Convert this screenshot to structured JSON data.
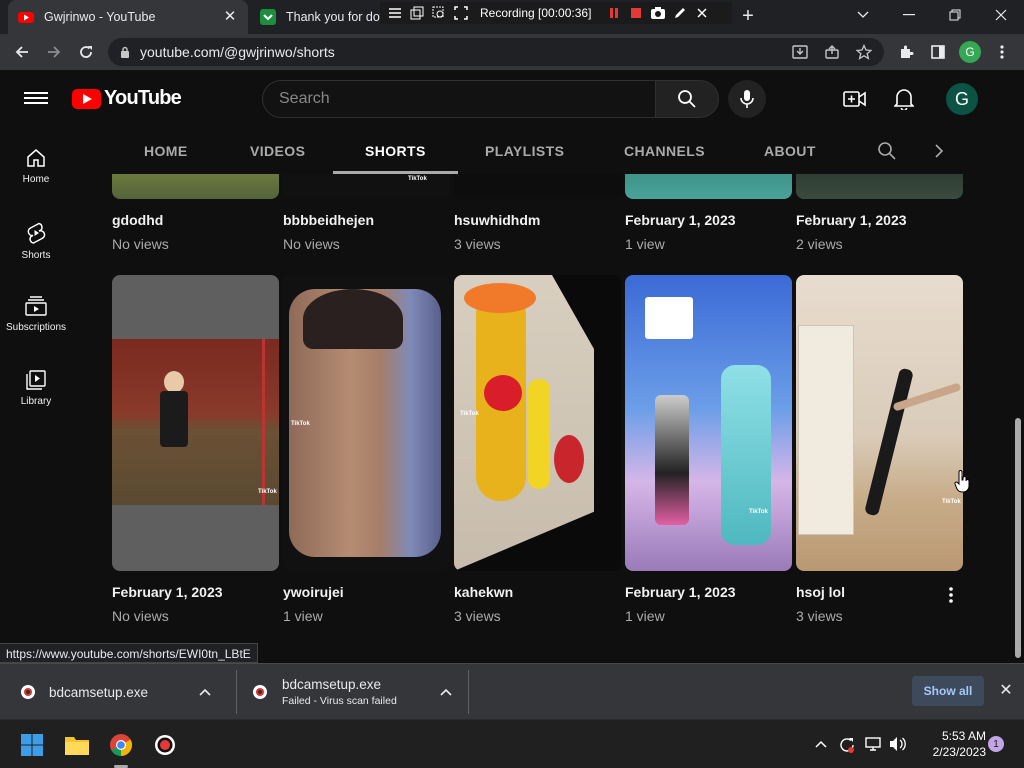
{
  "browser": {
    "tabs": [
      {
        "title": "Gwjrinwo - YouTube",
        "active": true
      },
      {
        "title": "Thank you for dow",
        "active": false
      }
    ],
    "url": "youtube.com/@gwjrinwo/shorts",
    "profile_initial": "G"
  },
  "recorder": {
    "label": "Recording [00:00:36]"
  },
  "youtube": {
    "logo_text": "YouTube",
    "search_placeholder": "Search",
    "avatar_initial": "G",
    "sidebar": [
      {
        "label": "Home",
        "icon": "home-icon"
      },
      {
        "label": "Shorts",
        "icon": "shorts-icon"
      },
      {
        "label": "Subscriptions",
        "icon": "subscriptions-icon"
      },
      {
        "label": "Library",
        "icon": "library-icon"
      }
    ],
    "channel_tabs": [
      "HOME",
      "VIDEOS",
      "SHORTS",
      "PLAYLISTS",
      "CHANNELS",
      "ABOUT"
    ],
    "active_tab": "SHORTS",
    "row1": [
      {
        "title": "gdodhd",
        "views": "No views"
      },
      {
        "title": "bbbbeidhejen",
        "views": "No views"
      },
      {
        "title": "hsuwhidhdm",
        "views": "3 views"
      },
      {
        "title": "February 1, 2023",
        "views": "1 view"
      },
      {
        "title": "February 1, 2023",
        "views": "2 views"
      }
    ],
    "row2": [
      {
        "title": "February 1, 2023",
        "views": "No views"
      },
      {
        "title": "ywoirujei",
        "views": "1 view"
      },
      {
        "title": "kahekwn",
        "views": "3 views"
      },
      {
        "title": "February 1, 2023",
        "views": "1 view"
      },
      {
        "title": "hsoj lol",
        "views": "3 views"
      }
    ],
    "watermark": "TikTok"
  },
  "status_url": "https://www.youtube.com/shorts/EWI0tn_LBtE",
  "downloads": [
    {
      "name": "bdcamsetup.exe",
      "status": ""
    },
    {
      "name": "bdcamsetup.exe",
      "status": "Failed - Virus scan failed"
    }
  ],
  "downloads_show_all": "Show all",
  "taskbar": {
    "time": "5:53 AM",
    "date": "2/23/2023",
    "notifications": "1"
  }
}
